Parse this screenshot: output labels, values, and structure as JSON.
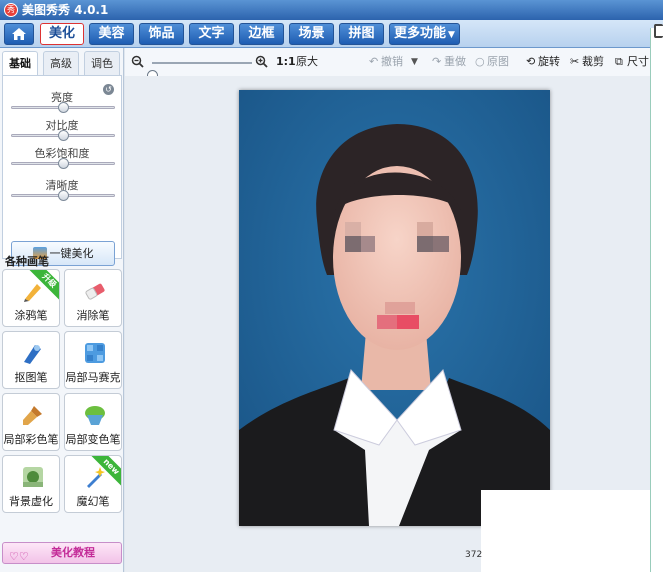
{
  "window": {
    "title": "美图秀秀 4.0.1",
    "icon_text": "秀"
  },
  "nav": {
    "tabs": [
      {
        "label": "美化"
      },
      {
        "label": "美容"
      },
      {
        "label": "饰品"
      },
      {
        "label": "文字"
      },
      {
        "label": "边框"
      },
      {
        "label": "场景"
      },
      {
        "label": "拼图"
      },
      {
        "label": "更多功能"
      }
    ],
    "active": "美化"
  },
  "left": {
    "subtabs": [
      {
        "label": "基础"
      },
      {
        "label": "高级"
      },
      {
        "label": "调色"
      }
    ],
    "sliders": [
      {
        "label": "亮度",
        "value": 0.5
      },
      {
        "label": "对比度",
        "value": 0.5
      },
      {
        "label": "色彩饱和度",
        "value": 0.5
      },
      {
        "label": "清晰度",
        "value": 0.5
      }
    ],
    "auto_button": "一键美化",
    "brush_title": "各种画笔",
    "brushes": [
      {
        "label": "涂鸦笔",
        "badge": "升级"
      },
      {
        "label": "消除笔",
        "badge": ""
      },
      {
        "label": "抠图笔",
        "badge": ""
      },
      {
        "label": "局部马赛克",
        "badge": ""
      },
      {
        "label": "局部彩色笔",
        "badge": ""
      },
      {
        "label": "局部变色笔",
        "badge": ""
      },
      {
        "label": "背景虚化",
        "badge": ""
      },
      {
        "label": "魔幻笔",
        "badge": "new"
      }
    ],
    "tutorial": "美化教程"
  },
  "toolbar": {
    "ratio": "1:1",
    "original": "原大",
    "undo": "撤销",
    "redo": "重做",
    "orig_img": "原图",
    "rotate": "旋转",
    "crop": "裁剪",
    "size": "尺寸",
    "zoom": 0.0
  },
  "status": {
    "text": "372"
  },
  "colors": {
    "accent": "#2c63ad",
    "photo_bg": "#1f5d94",
    "badge_green": "#3cb53a"
  }
}
